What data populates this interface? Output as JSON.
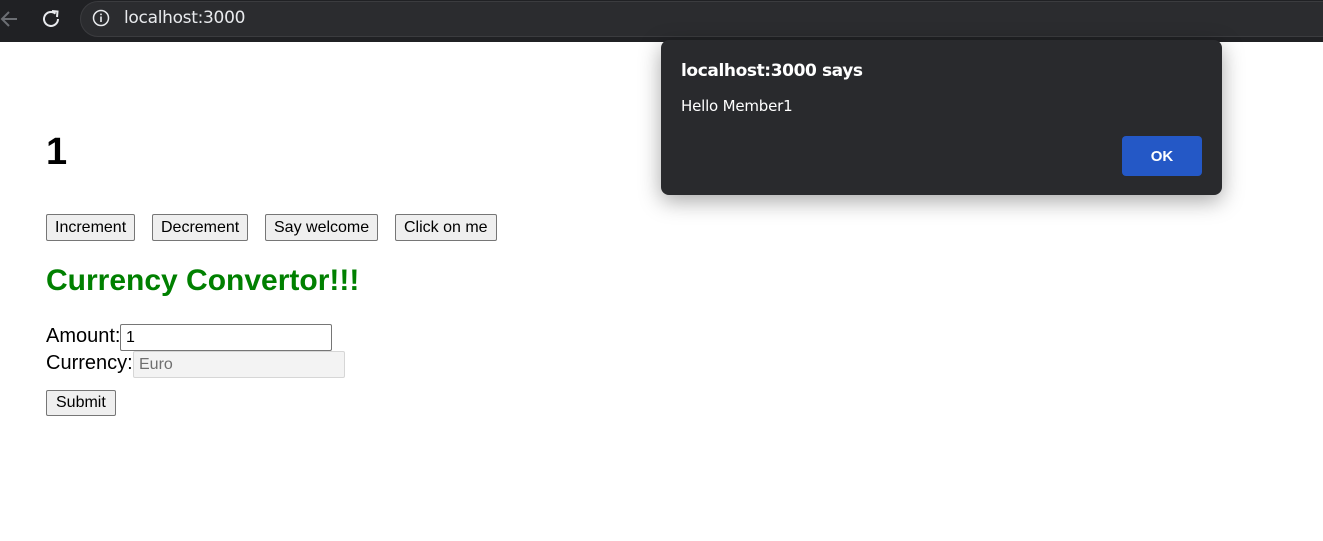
{
  "browser": {
    "url": "localhost:3000",
    "back_icon": "arrow-left-icon",
    "reload_icon": "reload-icon",
    "info_icon": "info-icon"
  },
  "page": {
    "count": "1",
    "buttons": {
      "increment": "Increment",
      "decrement": "Decrement",
      "say_welcome": "Say welcome",
      "click_on_me": "Click on me"
    },
    "converter": {
      "heading": "Currency Convertor!!!",
      "heading_color": "#008000",
      "amount_label": "Amount:",
      "amount_value": "1",
      "currency_label": "Currency:",
      "currency_value": "Euro",
      "submit_label": "Submit"
    }
  },
  "dialog": {
    "title": "localhost:3000 says",
    "message": "Hello Member1",
    "ok_label": "OK",
    "ok_color": "#2458c6"
  }
}
